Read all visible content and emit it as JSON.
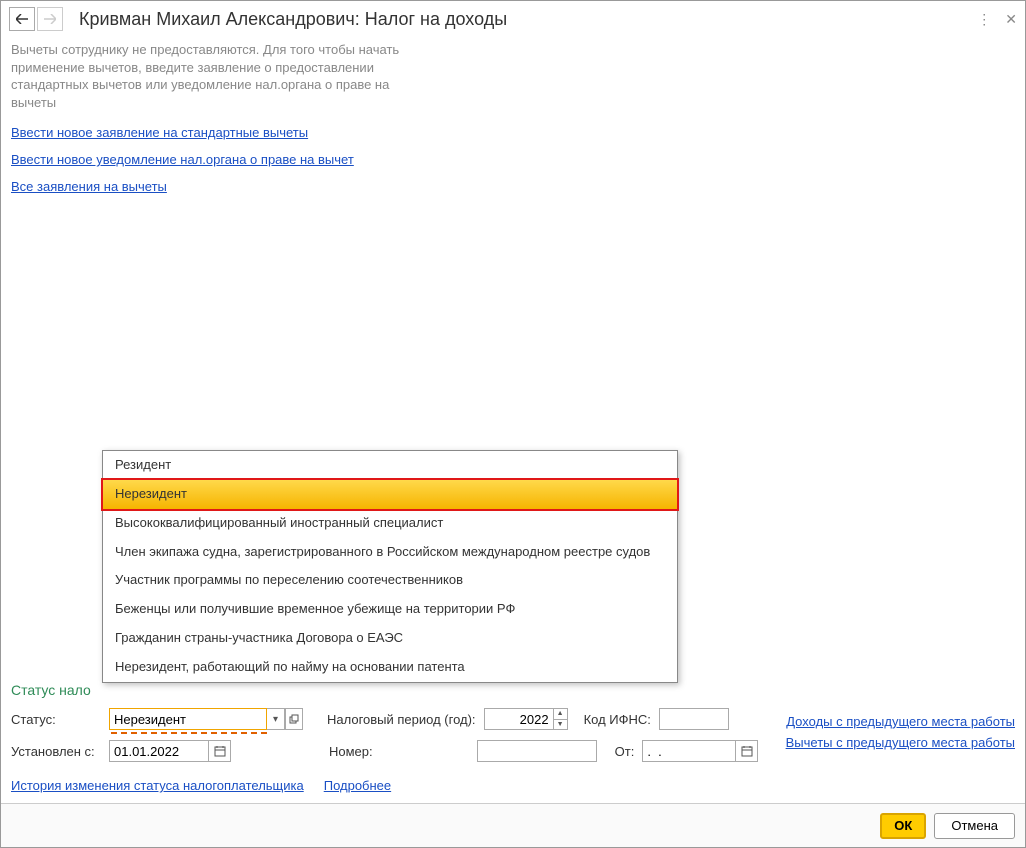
{
  "header": {
    "title": "Кривман Михаил Александрович: Налог на доходы"
  },
  "info_text": "Вычеты сотруднику не предоставляются. Для того чтобы начать применение вычетов, введите заявление о предоставлении стандартных вычетов или уведомление нал.органа о праве на вычеты",
  "links": {
    "new_standard": "Ввести новое заявление на стандартные вычеты",
    "new_notice": "Ввести новое уведомление нал.органа о праве на вычет",
    "all_applications": "Все заявления на вычеты"
  },
  "section_title": "Статус нало",
  "labels": {
    "status": "Статус:",
    "tax_period": "Налоговый период (год):",
    "ifns_code": "Код ИФНС:",
    "set_from": "Установлен с:",
    "number": "Номер:",
    "from": "От:"
  },
  "values": {
    "status": "Нерезидент",
    "tax_period": "2022",
    "ifns_code": "",
    "set_from": "01.01.2022",
    "number": "",
    "from_date": ".  ."
  },
  "right_links": {
    "income_prev": "Доходы с предыдущего места работы",
    "deductions_prev": "Вычеты с предыдущего места работы"
  },
  "bottom_links": {
    "history": "История изменения статуса налогоплательщика",
    "more": "Подробнее"
  },
  "dropdown": {
    "items": [
      "Резидент",
      "Нерезидент",
      "Высококвалифицированный иностранный специалист",
      "Член экипажа судна, зарегистрированного в Российском международном реестре судов",
      "Участник программы по переселению соотечественников",
      "Беженцы или получившие временное убежище на территории РФ",
      "Гражданин страны-участника Договора о ЕАЭС",
      "Нерезидент, работающий по найму на основании патента"
    ],
    "selected_index": 1
  },
  "footer": {
    "ok": "ОК",
    "cancel": "Отмена"
  }
}
